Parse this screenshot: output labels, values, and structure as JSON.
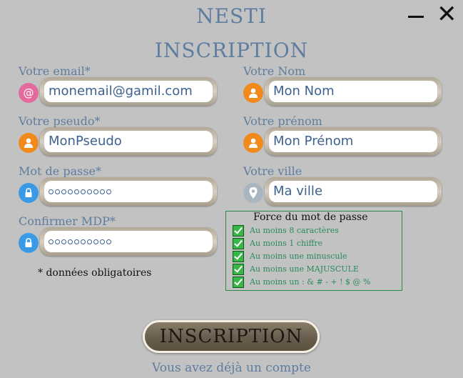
{
  "window": {
    "title": "NESTI",
    "subtitle": "INSCRIPTION",
    "minimize_label": "–",
    "close_label": "✕"
  },
  "colors": {
    "accent": "#5e7d9f",
    "background": "#c2c2c2",
    "valid": "#39b54a"
  },
  "form": {
    "email": {
      "label": "Votre email*",
      "value": "monemail@gamil.com",
      "icon": "at-icon"
    },
    "pseudo": {
      "label": "Votre pseudo*",
      "value": "MonPseudo",
      "icon": "user-icon"
    },
    "password": {
      "label": "Mot de passe*",
      "masked_length": 10,
      "icon": "lock-icon"
    },
    "confirm": {
      "label": "Confirmer MDP*",
      "masked_length": 10,
      "icon": "lock-icon"
    },
    "nom": {
      "label": "Votre Nom",
      "value": "Mon Nom",
      "icon": "user-icon"
    },
    "prenom": {
      "label": "Votre prénom",
      "value": "Mon Prénom",
      "icon": "user-icon"
    },
    "ville": {
      "label": "Votre ville",
      "value": "Ma ville",
      "icon": "map-pin-icon"
    }
  },
  "required_note": "* données obligatoires",
  "strength": {
    "title": "Force du mot de passe",
    "criteria": [
      "Au moins 8 caractères",
      "Au moins 1 chiffre",
      "Au moins une minuscule",
      "Au moins une MAJUSCULE",
      "Au moins un : & # - + ! $ @ %"
    ]
  },
  "submit_label": "INSCRIPTION",
  "login_link": "Vous avez déjà un compte"
}
